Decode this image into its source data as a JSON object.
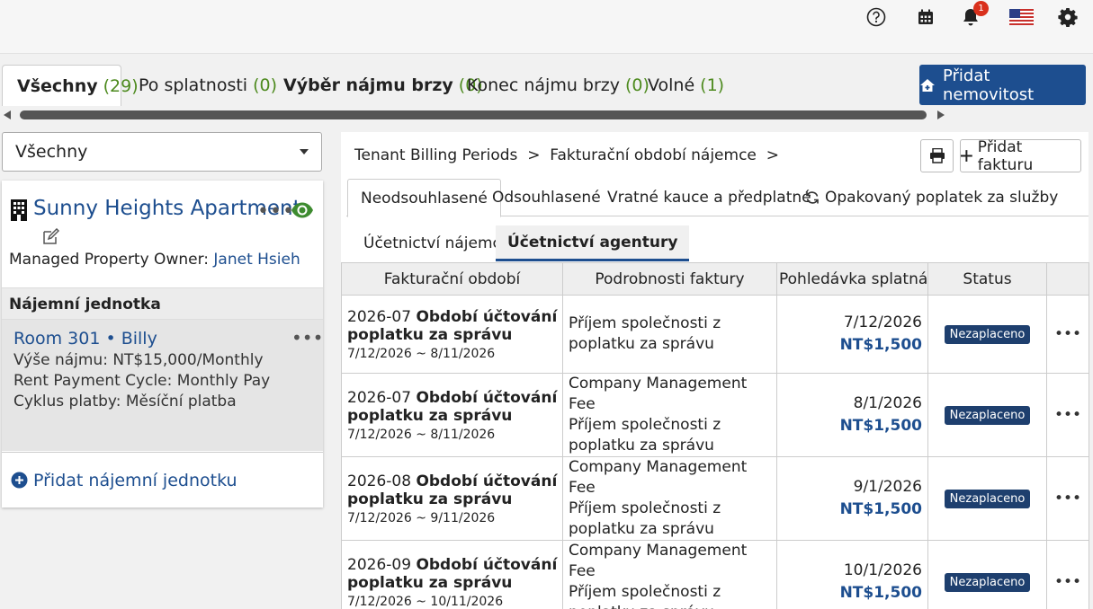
{
  "topbar": {
    "notifications_count": "1"
  },
  "tabs": [
    {
      "label": "Všechny",
      "count": "(29)"
    },
    {
      "label": "Po splatnosti",
      "count": "(0)"
    },
    {
      "label": "Výběr nájmu brzy",
      "count": "(0)"
    },
    {
      "label": "Konec nájmu brzy",
      "count": "(0)"
    },
    {
      "label": "Volné",
      "count": "(1)"
    }
  ],
  "add_property_label": "Přidat nemovitost",
  "filter": {
    "selected": "Všechny"
  },
  "property": {
    "name": "Sunny Heights Apartment",
    "owner_label": "Managed Property Owner:",
    "owner_name": "Janet Hsieh",
    "units_header": "Nájemní jednotka",
    "unit": {
      "title": "Room 301 • Billy",
      "rent": "Výše nájmu: NT$15,000/Monthly",
      "cycle_en": "Rent Payment Cycle: Monthly Pay",
      "cycle_cs": "Cyklus platby: Měsíční platba"
    },
    "add_unit_label": "Přidat nájemní jednotku"
  },
  "panel": {
    "breadcrumb_1": "Tenant Billing Periods",
    "breadcrumb_2": "Fakturační období nájemce",
    "add_invoice_label": "Přidat fakturu",
    "subtabs": [
      "Neodsouhlasené",
      "Odsouhlasené",
      "Vratné kauce a předplatné",
      "Opakovaný poplatek za služby"
    ],
    "subsubtabs": [
      "Účetnictví nájemce",
      "Účetnictví agentury"
    ],
    "columns": [
      "Fakturační období",
      "Podrobnosti faktury",
      "Pohledávka splatná dne",
      "Status"
    ],
    "rows": [
      {
        "period": "2026-07",
        "period_label": "Období účtování",
        "period_label2": "poplatku za správu",
        "range": "7/12/2026 ~ 8/11/2026",
        "detail_en": "",
        "detail_cs": "Příjem společnosti z poplatku za správu",
        "due_date": "7/12/2026",
        "amount": "NT$1,500",
        "status": "Nezaplaceno"
      },
      {
        "period": "2026-07",
        "period_label": "Období účtování",
        "period_label2": "poplatku za správu",
        "range": "7/12/2026 ~ 8/11/2026",
        "detail_en": "Company Management Fee",
        "detail_cs": "Příjem společnosti z poplatku za správu",
        "due_date": "8/1/2026",
        "amount": "NT$1,500",
        "status": "Nezaplaceno"
      },
      {
        "period": "2026-08",
        "period_label": "Období účtování",
        "period_label2": "poplatku za správu",
        "range": "7/12/2026 ~ 9/11/2026",
        "detail_en": "Company Management Fee",
        "detail_cs": "Příjem společnosti z poplatku za správu",
        "due_date": "9/1/2026",
        "amount": "NT$1,500",
        "status": "Nezaplaceno"
      },
      {
        "period": "2026-09",
        "period_label": "Období účtování",
        "period_label2": "poplatku za správu",
        "range": "7/12/2026 ~ 10/11/2026",
        "detail_en": "Company Management Fee",
        "detail_cs": "Příjem společnosti z poplatku za správu",
        "due_date": "10/1/2026",
        "amount": "NT$1,500",
        "status": "Nezaplaceno"
      }
    ]
  },
  "colors": {
    "brand": "#1d4e8f",
    "count_green": "#4d8a1e",
    "status_badge": "#1e3f6e",
    "notification_red": "#d9301c"
  }
}
